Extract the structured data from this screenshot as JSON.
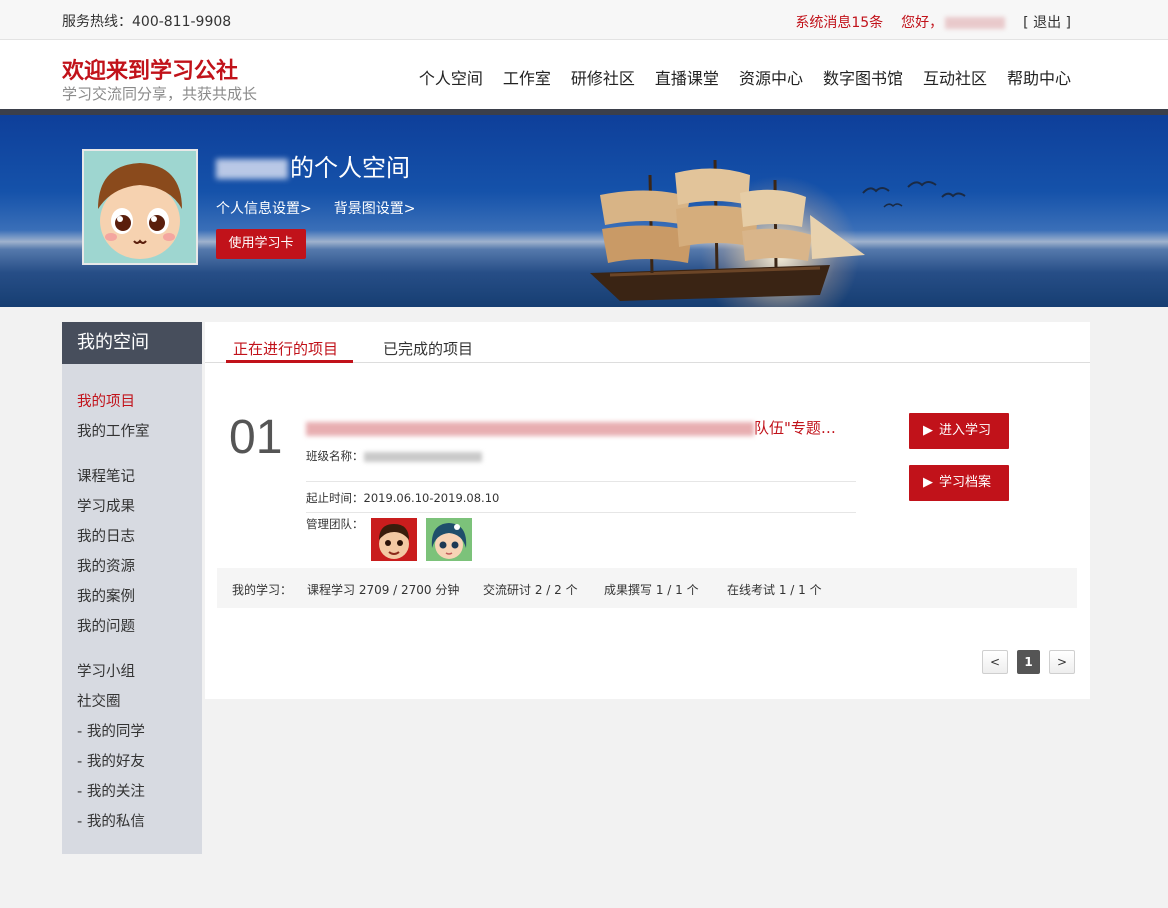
{
  "topbar": {
    "hotline": "服务热线：400-811-9908",
    "system_msg": "系统消息15条",
    "greeting": "您好，",
    "logout": "[ 退出 ]"
  },
  "header": {
    "site_title": "欢迎来到学习公社",
    "site_subtitle": "学习交流同分享，共获共成长",
    "nav": [
      "个人空间",
      "工作室",
      "研修社区",
      "直播课堂",
      "资源中心",
      "数字图书馆",
      "互动社区",
      "帮助中心"
    ]
  },
  "banner": {
    "space_title_suffix": "的个人空间",
    "profile_settings": "个人信息设置>",
    "bg_settings": "背景图设置>",
    "card_button": "使用学习卡"
  },
  "sidebar": {
    "title": "我的空间",
    "items": [
      "我的项目",
      "我的工作室",
      "课程笔记",
      "学习成果",
      "我的日志",
      "我的资源",
      "我的案例",
      "我的问题",
      "学习小组",
      "社交圈",
      "- 我的同学",
      "- 我的好友",
      "- 我的关注",
      "- 我的私信"
    ]
  },
  "tabs": {
    "active": "正在进行的项目",
    "done": "已完成的项目"
  },
  "project": {
    "number": "01",
    "title_tail": "队伍\"专题…",
    "class_label": "班级名称：",
    "period": "起止时间：2019.06.10-2019.08.10",
    "team_label": "管理团队：",
    "enter_button": "进入学习",
    "archive_button": "学习档案"
  },
  "stats": {
    "label": "我的学习：",
    "course": "课程学习  2709 / 2700 分钟",
    "discussion": "交流研讨  2 / 2 个",
    "writing": "成果撰写  1 / 1 个",
    "exam": "在线考试  1 / 1 个"
  },
  "pagination": {
    "prev": "<",
    "current": "1",
    "next": ">"
  },
  "colors": {
    "accent": "#c1121a",
    "sidebar_head": "#474e5c",
    "sidebar_bg": "#d7dae1"
  }
}
